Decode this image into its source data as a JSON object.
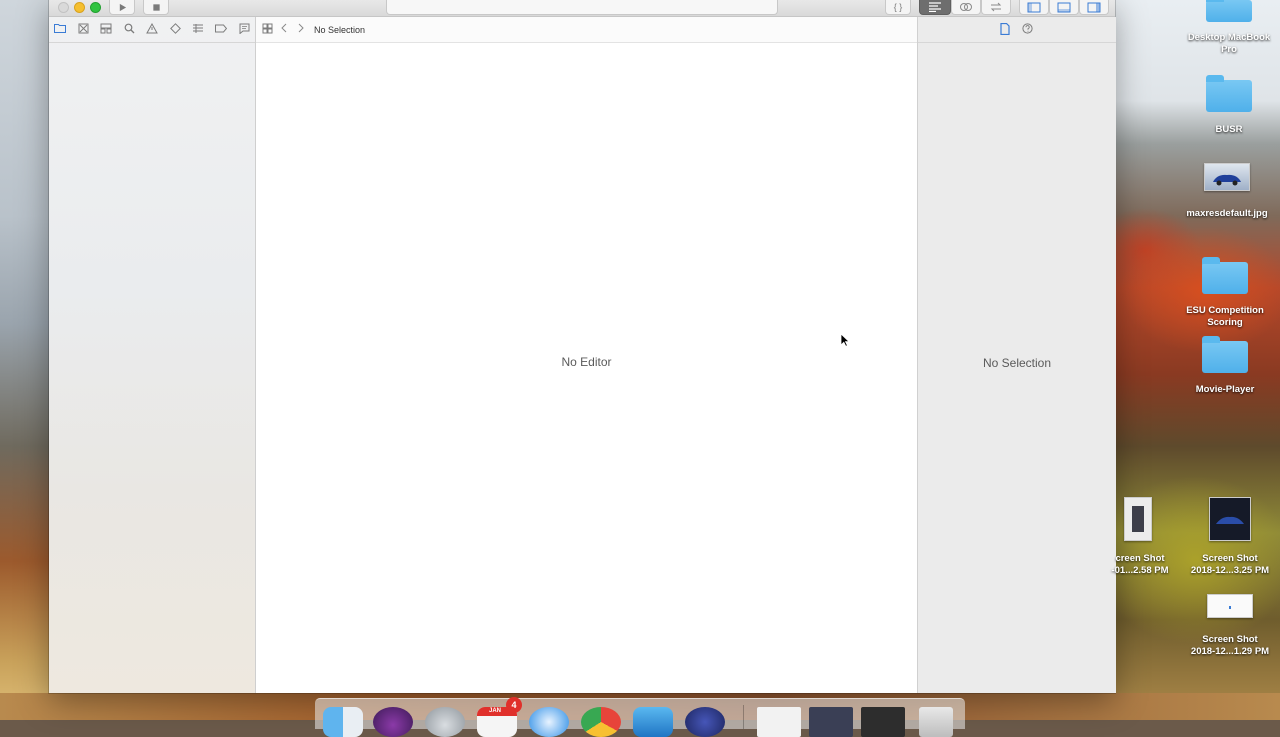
{
  "window": {
    "jump_bar_title": "No Selection",
    "editor_placeholder": "No Editor",
    "inspector_placeholder": "No Selection"
  },
  "toolbar": {
    "view_toggles": [
      "code-review-icon",
      "standard-editor-icon",
      "assistant-editor-icon",
      "version-editor-icon",
      "navigator-toggle-icon",
      "debug-area-toggle-icon",
      "utilities-toggle-icon"
    ]
  },
  "navigator": {
    "icons": [
      "folder-icon",
      "source-control-icon",
      "symbol-icon",
      "search-icon",
      "warning-icon",
      "test-icon",
      "debug-icon",
      "breakpoint-icon",
      "report-icon"
    ]
  },
  "desktop": {
    "items": [
      {
        "label": "Desktop MacBook Pro",
        "kind": "folder"
      },
      {
        "label": "BUSR",
        "kind": "folder"
      },
      {
        "label": "maxresdefault.jpg",
        "kind": "image"
      },
      {
        "label": "ESU Competition Scoring",
        "kind": "folder"
      },
      {
        "label": "Movie-Player",
        "kind": "folder"
      },
      {
        "label_line1": "creen Shot",
        "label_line2": "-01...2.58 PM",
        "kind": "screenshot"
      },
      {
        "label_line1": "Screen Shot",
        "label_line2": "2018-12...3.25 PM",
        "kind": "screenshot"
      },
      {
        "label_line1": "Screen Shot",
        "label_line2": "2018-12...1.29 PM",
        "kind": "screenshot"
      }
    ]
  },
  "dock": {
    "calendar_month": "JAN",
    "calendar_badge": "4"
  },
  "colors": {
    "accent": "#3a7bd5",
    "folder": "#4fb0ea",
    "badge": "#e0302b"
  }
}
